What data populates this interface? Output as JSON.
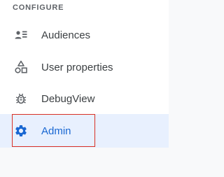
{
  "sidebar": {
    "section_header": "CONFIGURE",
    "items": [
      {
        "label": "Audiences",
        "icon": "audiences-icon"
      },
      {
        "label": "User properties",
        "icon": "user-properties-icon"
      },
      {
        "label": "DebugView",
        "icon": "debug-icon"
      },
      {
        "label": "Admin",
        "icon": "gear-icon",
        "selected": true
      }
    ]
  },
  "colors": {
    "accent": "#1967d2",
    "selected_bg": "#e8f0fe",
    "text": "#3c4043",
    "muted": "#5f6368",
    "highlight_border": "#d93025"
  }
}
